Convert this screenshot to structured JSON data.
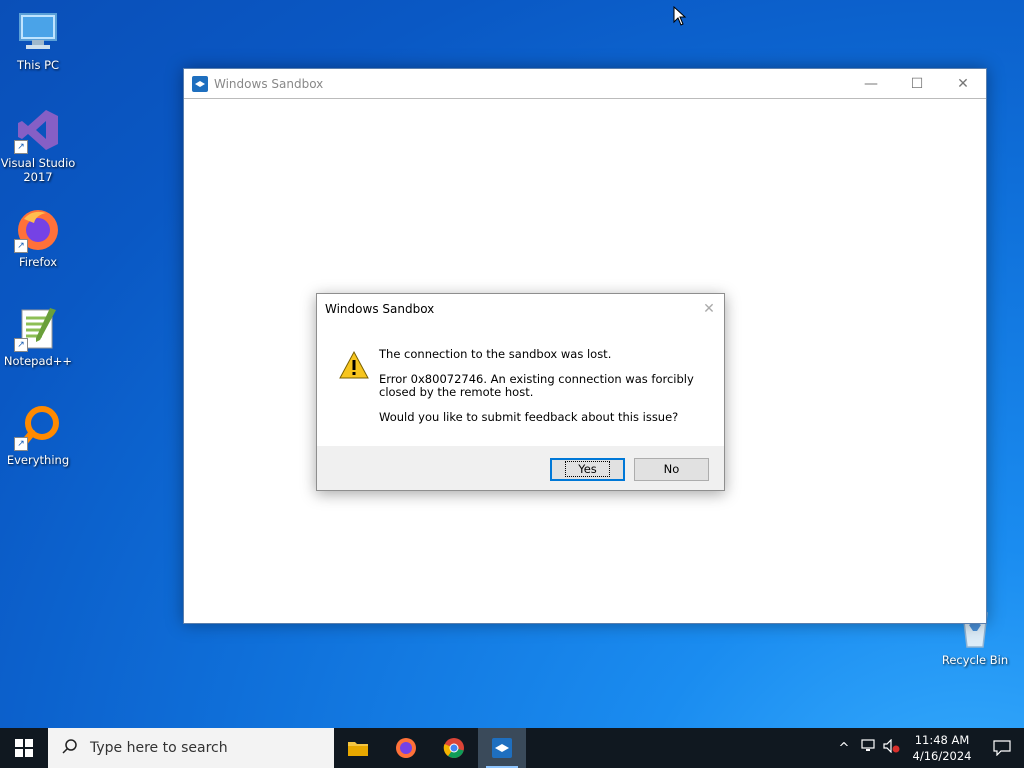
{
  "desktop": {
    "icons": [
      {
        "label": "This PC",
        "icon": "this-pc-icon"
      },
      {
        "label": "Visual Studio 2017",
        "icon": "visual-studio-icon"
      },
      {
        "label": "Firefox",
        "icon": "firefox-icon"
      },
      {
        "label": "Notepad++",
        "icon": "notepadpp-icon"
      },
      {
        "label": "Everything",
        "icon": "everything-icon"
      },
      {
        "label": "Recycle Bin",
        "icon": "recycle-bin-icon"
      }
    ]
  },
  "window": {
    "title": "Windows Sandbox",
    "minimize": "—",
    "maximize": "☐",
    "close": "✕"
  },
  "dialog": {
    "title": "Windows Sandbox",
    "close": "✕",
    "line1": "The connection to the sandbox was lost.",
    "line2": "Error 0x80072746. An existing connection was forcibly closed by the remote host.",
    "line3": "Would you like to submit feedback about this issue?",
    "yes_label": "Yes",
    "no_label": "No"
  },
  "taskbar": {
    "search_placeholder": "Type here to search",
    "apps": [
      "file-explorer-icon",
      "firefox-icon",
      "chrome-icon",
      "windows-sandbox-icon"
    ],
    "time": "11:48 AM",
    "date": "4/16/2024"
  },
  "colors": {
    "accent": "#0078d7",
    "desktop": "#0f6fd9",
    "taskbar": "#101820"
  }
}
